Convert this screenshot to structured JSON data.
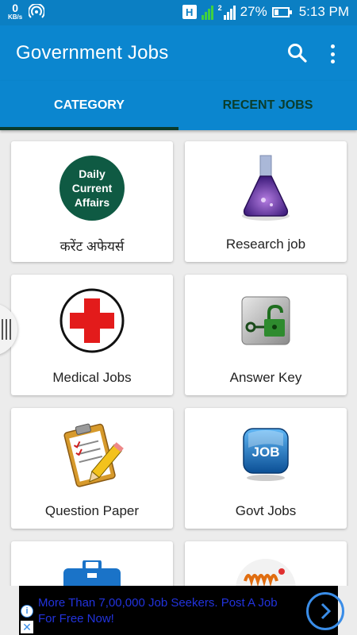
{
  "status_bar": {
    "net_speed": "0",
    "net_unit": "KB/s",
    "network_type": "H",
    "sim2_label": "2",
    "battery": "27%",
    "battery_level": 0.27,
    "time": "5:13 PM"
  },
  "app_bar": {
    "title": "Government Jobs",
    "icons": [
      "search-icon",
      "more-vert-icon"
    ]
  },
  "tabs": [
    {
      "label": "CATEGORY",
      "selected": true
    },
    {
      "label": "RECENT JOBS",
      "selected": false
    }
  ],
  "categories": [
    {
      "label": "करेंट अफेयर्स",
      "icon": "daily-current-affairs-icon",
      "badge_lines": [
        "Daily",
        "Current",
        "Affairs"
      ]
    },
    {
      "label": "Research job",
      "icon": "flask-icon"
    },
    {
      "label": "Medical Jobs",
      "icon": "medical-cross-icon"
    },
    {
      "label": "Answer Key",
      "icon": "unlock-key-icon"
    },
    {
      "label": "Question Paper",
      "icon": "clipboard-pencil-icon"
    },
    {
      "label": "Govt Jobs",
      "icon": "job-button-icon",
      "icon_text": "JOB"
    },
    {
      "label": "",
      "icon": "briefcase-icon"
    },
    {
      "label": "",
      "icon": "coil-icon"
    }
  ],
  "ad": {
    "text": "More Than 7,00,000 Job Seekers. Post A Job For Free Now!",
    "info_symbol": "i",
    "close_symbol": "✕"
  },
  "colors": {
    "primary": "#0b86cf",
    "status_bar": "#0b7fc3",
    "tab_indicator": "#0a3b2c",
    "background": "#ececec"
  }
}
